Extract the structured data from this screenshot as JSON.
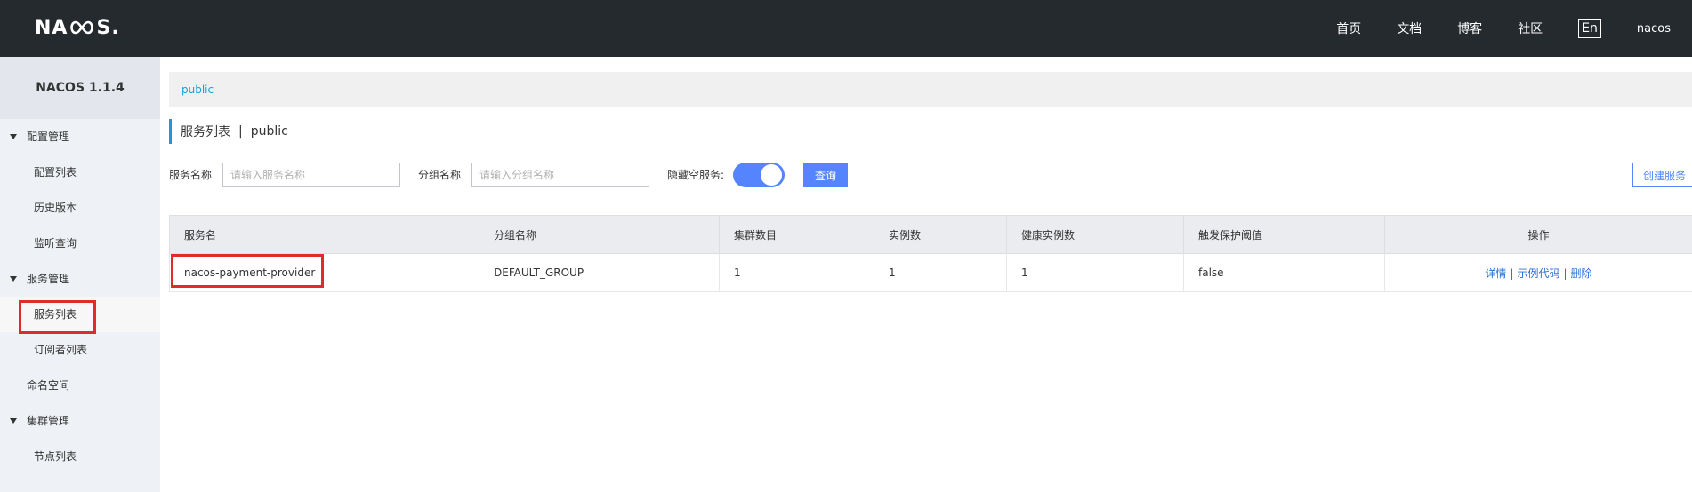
{
  "topbar": {
    "logo_text": "NACOS.",
    "nav": [
      "首页",
      "文档",
      "博客",
      "社区"
    ],
    "lang_label": "En",
    "user": "nacos"
  },
  "sidebar": {
    "title": "NACOS 1.1.4",
    "groups": {
      "config": "配置管理",
      "service": "服务管理",
      "cluster": "集群管理"
    },
    "items": {
      "config_list": "配置列表",
      "history": "历史版本",
      "listener": "监听查询",
      "service_list": "服务列表",
      "subscriber_list": "订阅者列表",
      "namespace": "命名空间",
      "node_list": "节点列表"
    }
  },
  "breadcrumb": {
    "namespace": "public"
  },
  "page": {
    "title": "服务列表",
    "separator": "|",
    "namespace": "public"
  },
  "filters": {
    "service_name_label": "服务名称",
    "service_name_placeholder": "请输入服务名称",
    "group_name_label": "分组名称",
    "group_name_placeholder": "请输入分组名称",
    "hide_empty_label": "隐藏空服务:",
    "hide_empty_on": true,
    "query_label": "查询",
    "create_label": "创建服务"
  },
  "table": {
    "headers": [
      "服务名",
      "分组名称",
      "集群数目",
      "实例数",
      "健康实例数",
      "触发保护阈值",
      "操作"
    ],
    "rows": [
      {
        "service": "nacos-payment-provider",
        "group": "DEFAULT_GROUP",
        "clusters": "1",
        "instances": "1",
        "healthy": "1",
        "threshold": "false",
        "ops": {
          "detail": "详情",
          "sample": "示例代码",
          "delete": "删除",
          "sep": "|"
        }
      }
    ]
  },
  "colors": {
    "topbar_bg": "#252a2f",
    "sidebar_bg": "#eef1f5",
    "accent": "#5584ff",
    "link": "#2b6fd6",
    "highlight_box": "#e02b2b"
  }
}
